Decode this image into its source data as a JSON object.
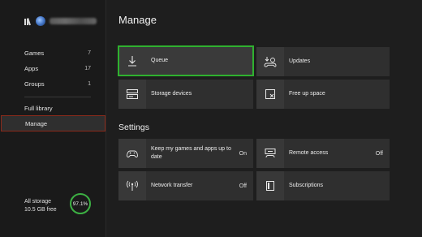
{
  "sidebar": {
    "items": [
      {
        "label": "Games",
        "count": "7"
      },
      {
        "label": "Apps",
        "count": "17"
      },
      {
        "label": "Groups",
        "count": "1"
      }
    ],
    "full_library": "Full library",
    "manage": "Manage",
    "storage_label": "All storage",
    "storage_free": "10.5 GB free",
    "storage_percent": "97.1%"
  },
  "main": {
    "title": "Manage",
    "tiles": [
      {
        "label": "Queue",
        "icon": "download-icon"
      },
      {
        "label": "Updates",
        "icon": "update-controller-icon"
      },
      {
        "label": "Storage devices",
        "icon": "hard-drive-icon"
      },
      {
        "label": "Free up space",
        "icon": "clear-space-icon"
      }
    ],
    "settings_title": "Settings",
    "settings": [
      {
        "label": "Keep my games and apps up to date",
        "value": "On",
        "icon": "controller-icon"
      },
      {
        "label": "Remote access",
        "value": "Off",
        "icon": "console-icon"
      },
      {
        "label": "Network transfer",
        "value": "Off",
        "icon": "wireless-icon"
      },
      {
        "label": "Subscriptions",
        "value": "",
        "icon": "subscription-icon"
      }
    ]
  },
  "colors": {
    "focus": "#2fb12f",
    "storage_ring": "#3cb043",
    "selected_border": "#8a2a1a"
  }
}
